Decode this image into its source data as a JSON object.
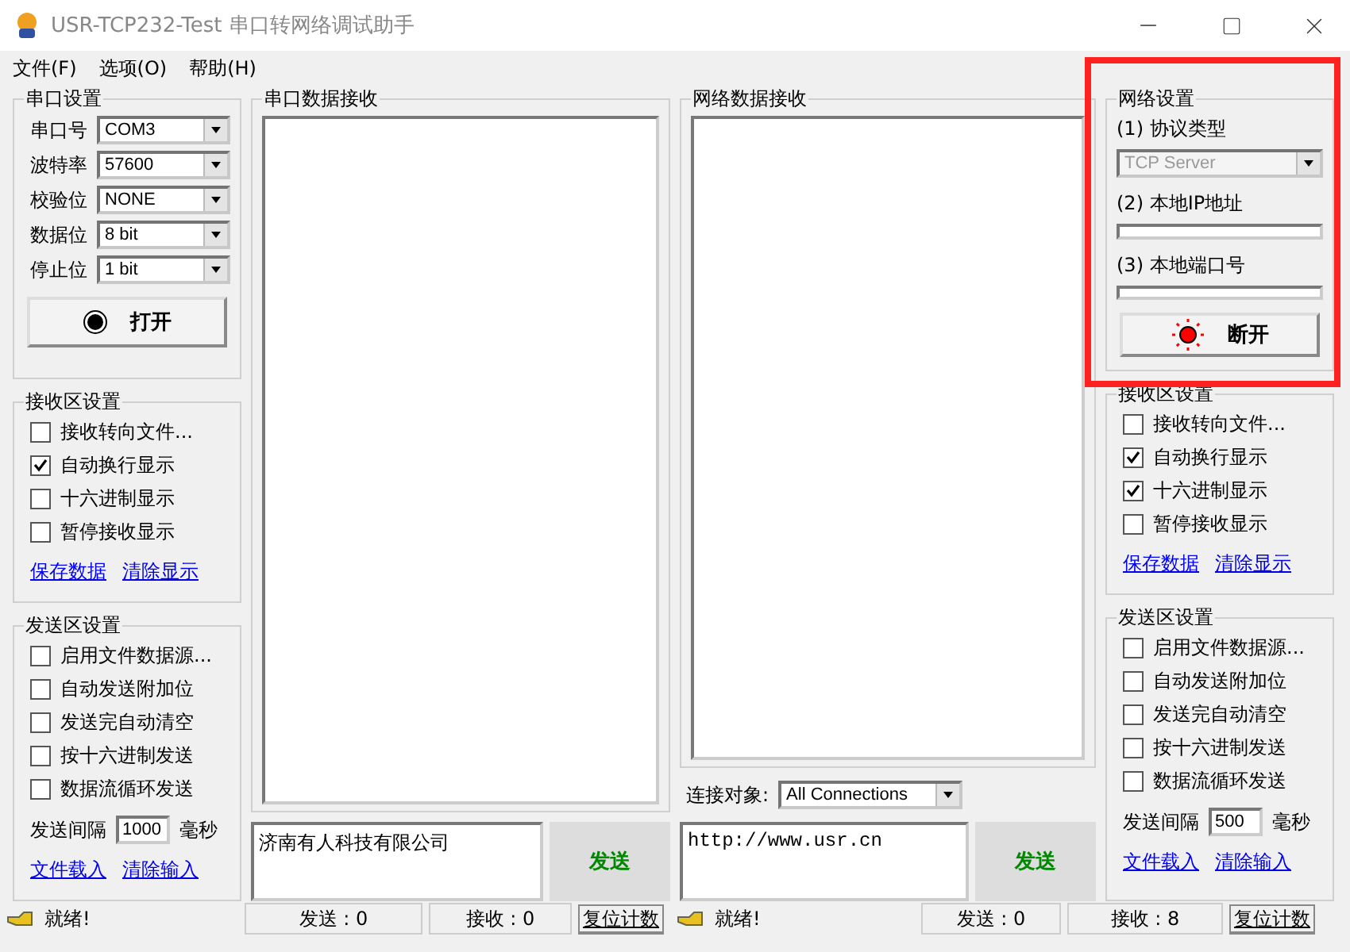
{
  "window": {
    "title": "USR-TCP232-Test 串口转网络调试助手"
  },
  "menu": [
    "文件(F)",
    "选项(O)",
    "帮助(H)"
  ],
  "serial_settings": {
    "title": "串口设置",
    "fields": [
      {
        "label": "串口号",
        "value": "COM3"
      },
      {
        "label": "波特率",
        "value": "57600"
      },
      {
        "label": "校验位",
        "value": "NONE"
      },
      {
        "label": "数据位",
        "value": "8 bit"
      },
      {
        "label": "停止位",
        "value": "1 bit"
      }
    ],
    "button": {
      "label": "打开",
      "connected": false
    }
  },
  "left_receive_settings": {
    "title": "接收区设置",
    "options": [
      {
        "label": "接收转向文件...",
        "checked": false
      },
      {
        "label": "自动换行显示",
        "checked": true
      },
      {
        "label": "十六进制显示",
        "checked": false
      },
      {
        "label": "暂停接收显示",
        "checked": false
      }
    ],
    "links": [
      "保存数据",
      "清除显示"
    ]
  },
  "left_send_settings": {
    "title": "发送区设置",
    "options": [
      {
        "label": "启用文件数据源...",
        "checked": false
      },
      {
        "label": "自动发送附加位",
        "checked": false
      },
      {
        "label": "发送完自动清空",
        "checked": false
      },
      {
        "label": "按十六进制发送",
        "checked": false
      },
      {
        "label": "数据流循环发送",
        "checked": false
      }
    ],
    "interval_label": "发送间隔",
    "interval_value": "1000",
    "interval_unit": "毫秒",
    "links": [
      "文件载入",
      "清除输入"
    ]
  },
  "serial_receive": {
    "title": "串口数据接收"
  },
  "serial_send": {
    "text": "济南有人科技有限公司",
    "button": "发送"
  },
  "net_receive": {
    "title": "网络数据接收",
    "target_label": "连接对象:",
    "target_value": "All Connections"
  },
  "net_send": {
    "text": "http://www.usr.cn",
    "button": "发送"
  },
  "net_settings": {
    "title": "网络设置",
    "highlighted": true,
    "protocol_label": "(1) 协议类型",
    "protocol_value": "TCP Server",
    "protocol_disabled": true,
    "ip_label": "(2) 本地IP地址",
    "port_label": "(3) 本地端口号",
    "button": {
      "label": "断开",
      "connected": true
    }
  },
  "right_receive_settings": {
    "title": "接收区设置",
    "options": [
      {
        "label": "接收转向文件...",
        "checked": false
      },
      {
        "label": "自动换行显示",
        "checked": true
      },
      {
        "label": "十六进制显示",
        "checked": true
      },
      {
        "label": "暂停接收显示",
        "checked": false
      }
    ],
    "links": [
      "保存数据",
      "清除显示"
    ]
  },
  "right_send_settings": {
    "title": "发送区设置",
    "options": [
      {
        "label": "启用文件数据源...",
        "checked": false
      },
      {
        "label": "自动发送附加位",
        "checked": false
      },
      {
        "label": "发送完自动清空",
        "checked": false
      },
      {
        "label": "按十六进制发送",
        "checked": false
      },
      {
        "label": "数据流循环发送",
        "checked": false
      }
    ],
    "interval_label": "发送间隔",
    "interval_value": "500",
    "interval_unit": "毫秒",
    "links": [
      "文件载入",
      "清除输入"
    ]
  },
  "status_bar": {
    "serial": {
      "ready": "就绪!",
      "sent": "发送 : 0",
      "received": "接收 : 0",
      "reset": "复位计数"
    },
    "net": {
      "ready": "就绪!",
      "sent": "发送 : 0",
      "received": "接收 : 8",
      "reset": "复位计数"
    }
  }
}
